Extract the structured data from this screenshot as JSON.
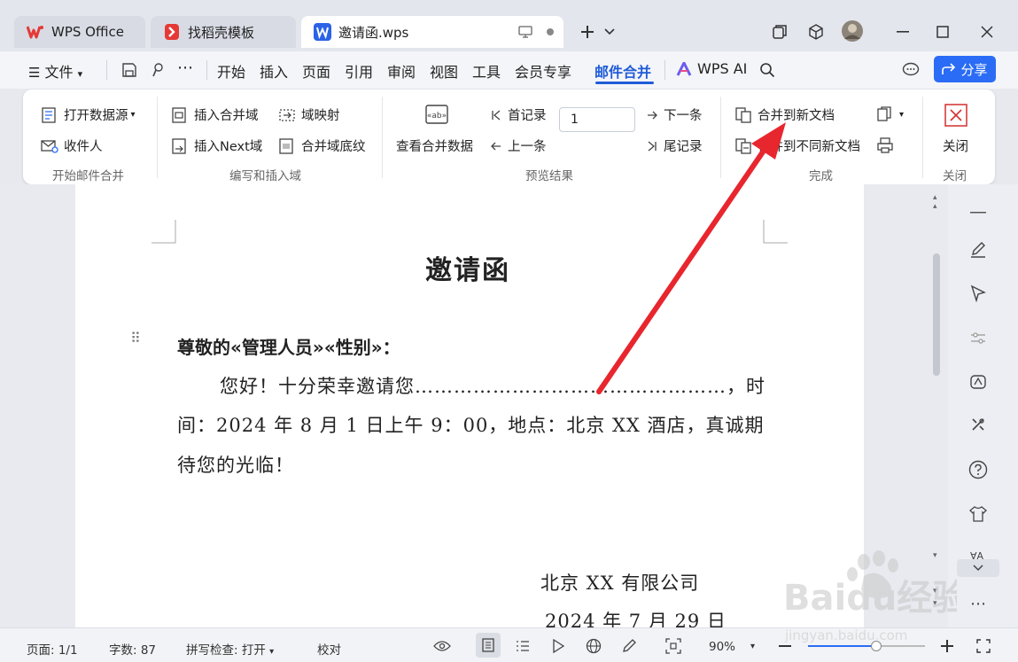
{
  "tabs": [
    {
      "label": "WPS Office",
      "icon": "wps-logo-icon"
    },
    {
      "label": "找稻壳模板",
      "icon": "docer-logo-icon"
    },
    {
      "label": "邀请函.wps",
      "icon": "word-doc-icon"
    }
  ],
  "menu": {
    "file_label": "文件",
    "items": [
      "开始",
      "插入",
      "页面",
      "引用",
      "审阅",
      "视图",
      "工具",
      "会员专享",
      "邮件合并"
    ],
    "active": "邮件合并",
    "wps_ai_label": "WPS AI",
    "share_label": "分享"
  },
  "ribbon": {
    "group1": {
      "name": "开始邮件合并",
      "open_source": "打开数据源",
      "recipients": "收件人"
    },
    "group2": {
      "name": "编写和插入域",
      "insert_field": "插入合并域",
      "field_map": "域映射",
      "insert_next": "插入Next域",
      "field_shading": "合并域底纹"
    },
    "group3": {
      "name": "预览结果",
      "view_data": "查看合并数据",
      "first": "首记录",
      "prev": "上一条",
      "record_value": "1",
      "next": "下一条",
      "last": "尾记录"
    },
    "group4": {
      "name": "完成",
      "merge_new": "合并到新文档",
      "merge_diff": "合并到不同新文档"
    },
    "group5": {
      "name": "关闭",
      "close": "关闭"
    }
  },
  "document": {
    "title": "邀请函",
    "salutation": "尊敬的«管理人员»«性别»：",
    "body_line1": "您好！十分荣幸邀请您…………………………………………，时",
    "body_line2": "间：2024 年 8 月 1 日上午 9：00，地点：北京 XX 酒店，真诚期",
    "body_line3": "待您的光临！",
    "company": "北京 XX 有限公司",
    "date": "2024 年 7 月 29 日"
  },
  "status": {
    "page": "页面: 1/1",
    "words": "字数: 87",
    "spell": "拼写检查: 打开",
    "proof": "校对",
    "zoom": "90%",
    "zoom_fraction": 0.58
  },
  "watermark": {
    "brand": "Baidu经验",
    "url": "jingyan.baidu.com"
  },
  "colors": {
    "accent": "#1f5cd8",
    "arrow": "#e8262e",
    "wps_red": "#e53935"
  }
}
